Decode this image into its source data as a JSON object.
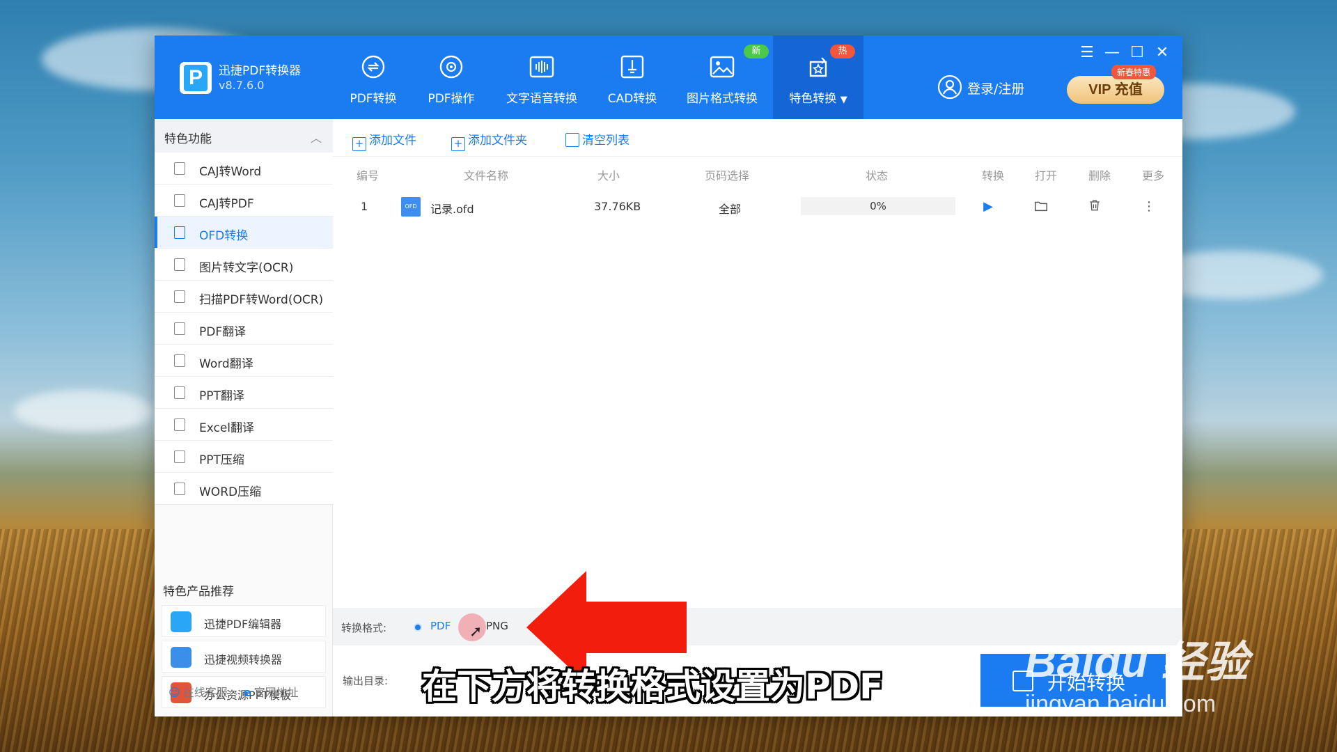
{
  "app": {
    "name": "迅捷PDF转换器",
    "version": "v8.7.6.0"
  },
  "nav": [
    {
      "label": "PDF转换"
    },
    {
      "label": "PDF操作"
    },
    {
      "label": "文字语音转换"
    },
    {
      "label": "CAD转换"
    },
    {
      "label": "图片格式转换",
      "badge": "新"
    },
    {
      "label": "特色转换",
      "badge": "热"
    }
  ],
  "header": {
    "login": "登录/注册",
    "vip_tag": "新春特惠",
    "vip_label": "VIP 充值"
  },
  "sidebar": {
    "section_title": "特色功能",
    "items": [
      {
        "label": "CAJ转Word"
      },
      {
        "label": "CAJ转PDF"
      },
      {
        "label": "OFD转换"
      },
      {
        "label": "图片转文字(OCR)"
      },
      {
        "label": "扫描PDF转Word(OCR)"
      },
      {
        "label": "PDF翻译"
      },
      {
        "label": "Word翻译"
      },
      {
        "label": "PPT翻译"
      },
      {
        "label": "Excel翻译"
      },
      {
        "label": "PPT压缩"
      },
      {
        "label": "WORD压缩"
      }
    ],
    "products_title": "特色产品推荐",
    "products": [
      {
        "label": "迅捷PDF编辑器"
      },
      {
        "label": "迅捷视频转换器"
      },
      {
        "label": "办公资源PPT模板"
      }
    ],
    "footer": {
      "service": "在线客服",
      "website": "官网地址"
    }
  },
  "toolbar": {
    "add_file": "添加文件",
    "add_folder": "添加文件夹",
    "clear_list": "清空列表"
  },
  "table": {
    "headers": {
      "num": "编号",
      "name": "文件名称",
      "size": "大小",
      "pages": "页码选择",
      "status": "状态",
      "convert": "转换",
      "open": "打开",
      "delete": "删除",
      "more": "更多"
    },
    "rows": [
      {
        "num": "1",
        "file_icon": "OFD",
        "name": "记录.ofd",
        "size": "37.76KB",
        "pages": "全部",
        "status": "0%",
        "progress": 0
      }
    ]
  },
  "bottom": {
    "format_label": "转换格式:",
    "format_options": [
      "PDF",
      "PNG"
    ],
    "selected_format": "PDF",
    "output_label": "输出目录:",
    "start_button": "开始转换"
  },
  "overlay": {
    "caption": "在下方将转换格式设置为PDF",
    "watermark_brand": "Baidu 经验",
    "watermark_url": "jingyan.baidu.com",
    "arrow_color": "#f21d0c"
  },
  "colors": {
    "primary": "#1a7cf0",
    "badge_new": "#4cc84a",
    "badge_hot": "#f2563c"
  }
}
